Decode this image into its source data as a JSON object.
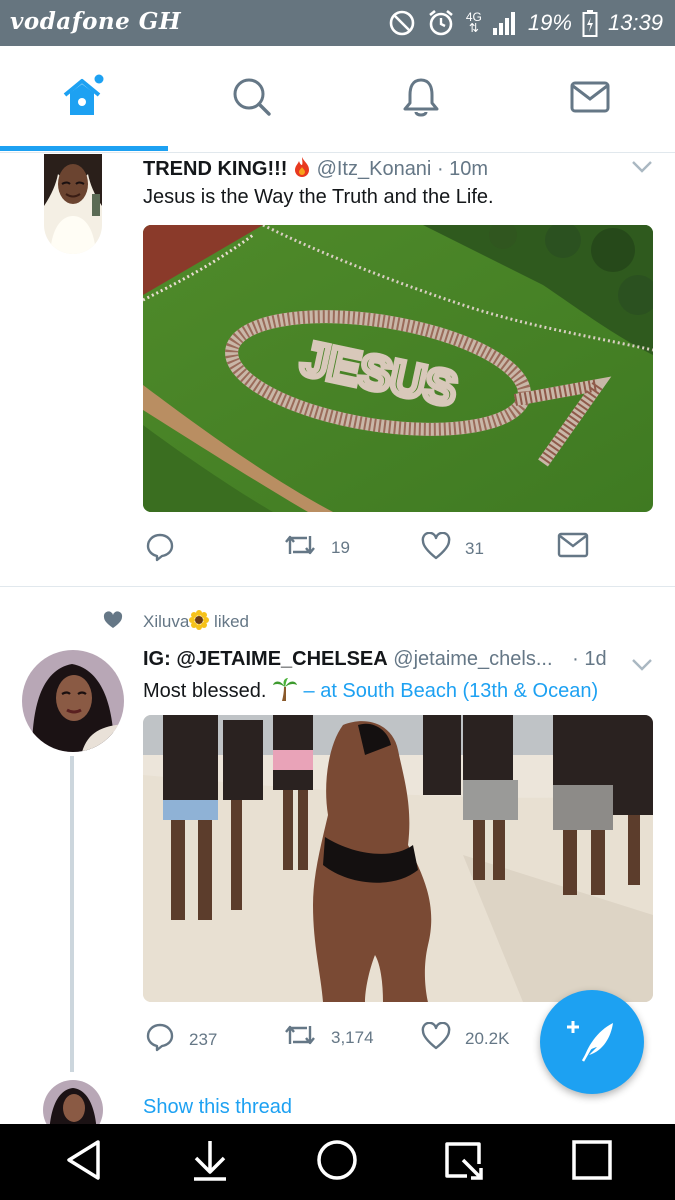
{
  "status_bar": {
    "carrier": "vodafone GH",
    "network": "4G",
    "battery": "19%",
    "time": "13:39",
    "icons": [
      "do-not-disturb-icon",
      "alarm-icon",
      "signal-icon",
      "battery-icon"
    ]
  },
  "tabs": [
    {
      "name": "home",
      "icon": "home-icon",
      "active": true
    },
    {
      "name": "search",
      "icon": "search-icon",
      "active": false
    },
    {
      "name": "notifications",
      "icon": "bell-icon",
      "active": false
    },
    {
      "name": "messages",
      "icon": "mail-icon",
      "active": false
    }
  ],
  "accent_color": "#1da1f2",
  "tweets": [
    {
      "name": "TREND KING!!!",
      "name_emoji": "fire-icon",
      "handle": "@Itz_Konani",
      "time": "· 10m",
      "text": "Jesus is the Way the Truth and the Life.",
      "media_text": "JESUS",
      "replies": "",
      "retweets": "19",
      "likes": "31"
    },
    {
      "social_context": {
        "name": "Xiluva",
        "emoji": "sunflower-icon",
        "action": "liked"
      },
      "name": "IG: @JETAIME_CHELSEA",
      "handle": "@jetaime_chels...",
      "time": "· 1d",
      "text": "Most blessed.",
      "text_emoji": "palm-tree-icon",
      "location": "– at South Beach (13th & Ocean)",
      "replies": "237",
      "retweets": "3,174",
      "likes": "20.2K"
    }
  ],
  "show_thread": "Show this thread"
}
